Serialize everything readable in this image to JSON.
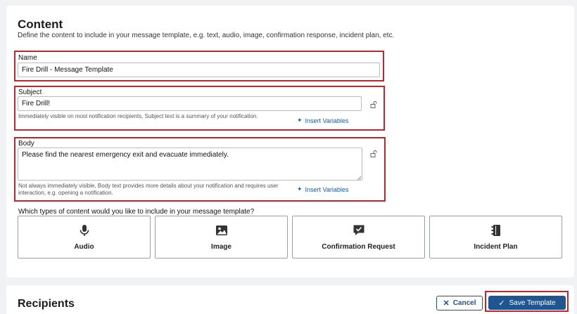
{
  "content": {
    "title": "Content",
    "description": "Define the content to include in your message template, e.g. text, audio, image, confirmation response, incident plan, etc.",
    "name": {
      "label": "Name",
      "value": "Fire Drill - Message Template"
    },
    "subject": {
      "label": "Subject",
      "value": "Fire Drill!",
      "help": "Immediately visible on most notification recipients, Subject text is a summary of your notification.",
      "insert_label": "Insert Variables"
    },
    "body": {
      "label": "Body",
      "value": "Please find the nearest emergency exit and evacuate immediately.",
      "help": "Not always immediately visible, Body text provides more details about your notification and requires user interaction, e.g. opening a notification.",
      "insert_label": "Insert Variables"
    },
    "question": "Which types of content would you like to include in your message template?",
    "types": [
      {
        "label": "Audio",
        "icon": "microphone-icon"
      },
      {
        "label": "Image",
        "icon": "image-icon"
      },
      {
        "label": "Confirmation Request",
        "icon": "confirmation-icon"
      },
      {
        "label": "Incident Plan",
        "icon": "binder-icon"
      }
    ]
  },
  "recipients": {
    "title": "Recipients"
  },
  "actions": {
    "cancel_label": "Cancel",
    "save_label": "Save Template"
  },
  "colors": {
    "highlight": "#c0272d",
    "primary": "#1f5591",
    "link": "#1c5a9c"
  }
}
